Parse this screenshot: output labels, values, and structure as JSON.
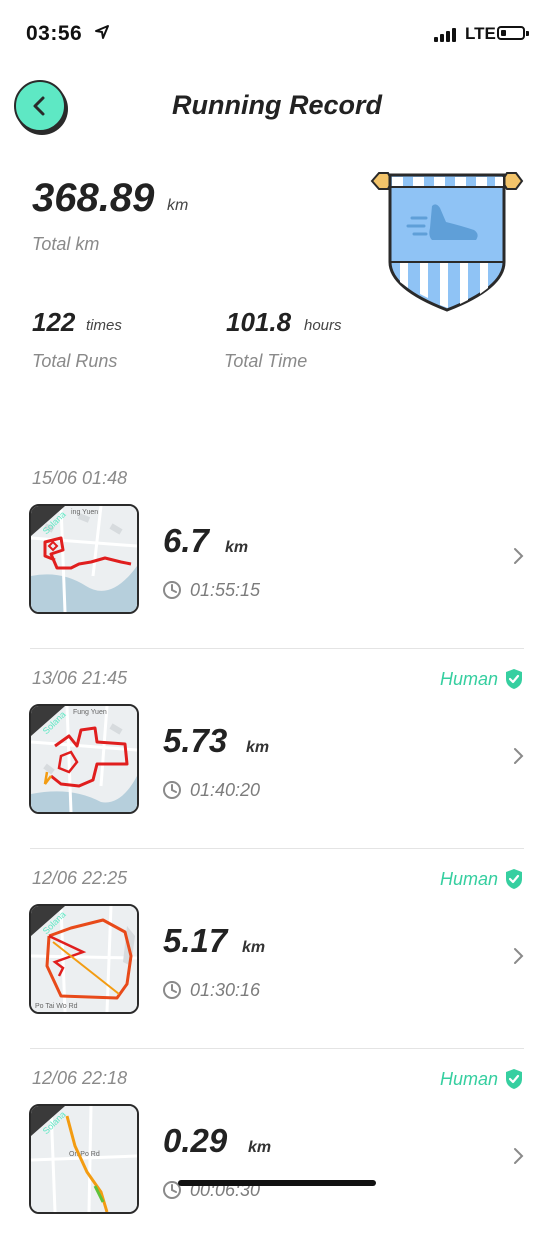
{
  "status_bar": {
    "time": "03:56",
    "network": "LTE"
  },
  "header": {
    "title": "Running Record"
  },
  "summary": {
    "total_km": {
      "value": "368.89",
      "unit": "km",
      "label": "Total km"
    },
    "total_runs": {
      "value": "122",
      "unit": "times",
      "label": "Total Runs"
    },
    "total_time": {
      "value": "101.8",
      "unit": "hours",
      "label": "Total Time"
    }
  },
  "records": [
    {
      "date": "15/06 01:48",
      "human": "",
      "tag": "Solana",
      "distance": "6.7",
      "unit": "km",
      "duration": "01:55:15",
      "map_label": "ing Yuen"
    },
    {
      "date": "13/06 21:45",
      "human": "Human",
      "tag": "Solana",
      "distance": "5.73",
      "unit": "km",
      "duration": "01:40:20",
      "map_label": "Fung Yuen"
    },
    {
      "date": "12/06 22:25",
      "human": "Human",
      "tag": "Solana",
      "distance": "5.17",
      "unit": "km",
      "duration": "01:30:16",
      "map_label": "Po Tai Wo Rd"
    },
    {
      "date": "12/06 22:18",
      "human": "Human",
      "tag": "Solana",
      "distance": "0.29",
      "unit": "km",
      "duration": "00:06:30",
      "map_label": "On Po Rd"
    }
  ],
  "colors": {
    "accent": "#5ee8c4",
    "human_green": "#36cfa0",
    "banner_blue": "#8fc3f5",
    "route_red": "#e01e1e"
  },
  "icons": [
    "back-arrow-icon",
    "location-arrow-icon",
    "clock-icon",
    "chevron-right-icon",
    "verified-shield-icon",
    "running-shoe-icon"
  ]
}
